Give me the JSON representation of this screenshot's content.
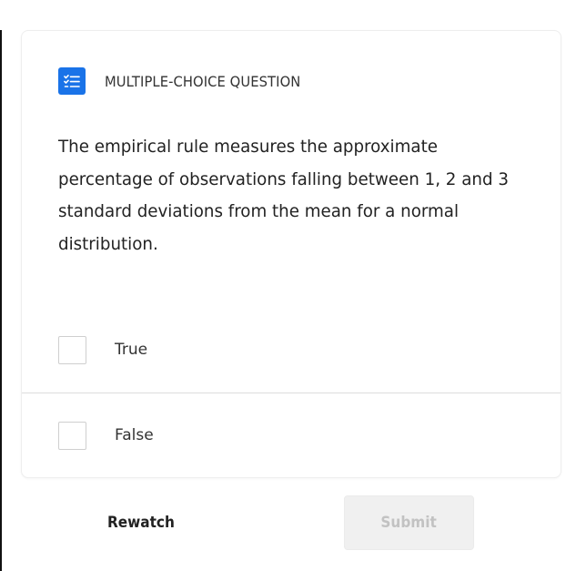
{
  "question": {
    "type_label": "MULTIPLE-CHOICE QUESTION",
    "text": "The empirical rule measures the approximate percentage of observations falling between 1, 2 and 3 standard deviations from the mean for a normal distribution.",
    "icon": "checklist-icon",
    "accent_color": "#1a73e8"
  },
  "options": [
    {
      "label": "True",
      "checked": false
    },
    {
      "label": "False",
      "checked": false
    }
  ],
  "actions": {
    "rewatch_label": "Rewatch",
    "submit_label": "Submit",
    "submit_enabled": false
  }
}
